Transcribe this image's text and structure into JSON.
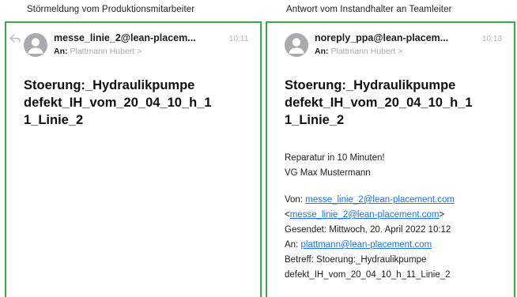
{
  "captions": {
    "left": "Störmeldung vom Produktionsmitarbeiter",
    "right": "Antwort vom Instandhalter an Teamleiter"
  },
  "left_email": {
    "sender": "messe_linie_2@lean-placem...",
    "time": "10:11",
    "to_label": "An:",
    "to_name": "Plattmann Hubert >",
    "subject_lines": [
      "Stoerung:_Hydraulikpumpe",
      "defekt_IH_vom_20_04_10_h_1",
      "1_Linie_2"
    ]
  },
  "right_email": {
    "sender": "noreply_ppa@lean-placem...",
    "time": "10:13",
    "to_label": "An:",
    "to_name": "Plattmann Hubert >",
    "subject_lines": [
      "Stoerung:_Hydraulikpumpe",
      "defekt_IH_vom_20_04_10_h_1",
      "1_Linie_2"
    ],
    "body": {
      "line1": "Reparatur in 10 Minuten!",
      "line2": "VG Max Mustermann",
      "from_label": "Von:",
      "from_link": "messe_linie_2@lean-placement.com",
      "from_link2": "messe_linie_2@lean-placement.com",
      "sent": "Gesendet: Mittwoch, 20. April 2022 10:12",
      "to_label": "An:",
      "to_link": "plattmann@lean-placement.com",
      "subject_label": "Betreff: Stoerung:_Hydraulikpumpe",
      "subject_rest": "defekt_IH_vom_20_04_10_h_11_Linie_2"
    }
  },
  "colors": {
    "panel_border": "#3aaa4a",
    "link": "#1a73e8",
    "muted": "#a7a7ad",
    "avatar": "#a9a9ae"
  },
  "icons": {
    "reply": "reply-arrow-icon",
    "avatar": "person-avatar-icon"
  }
}
